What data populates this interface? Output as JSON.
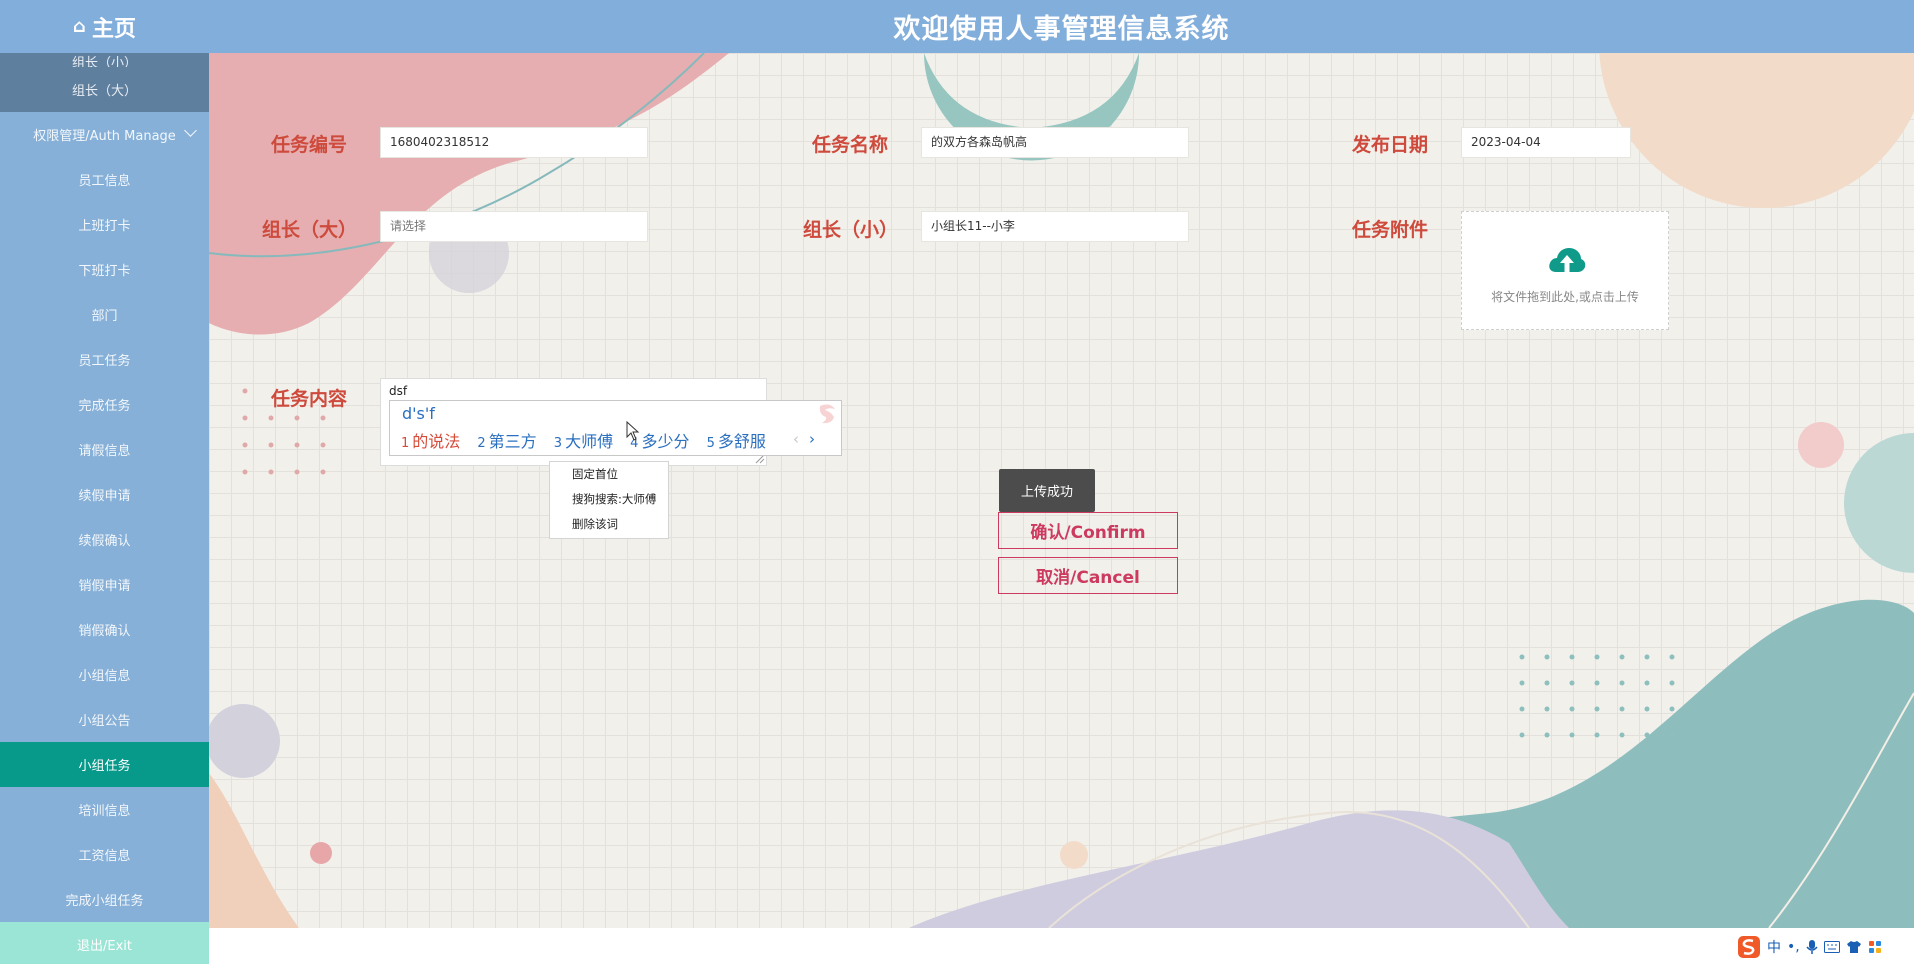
{
  "header": {
    "home_icon": "home-icon",
    "home_label": "主页",
    "title": "欢迎使用人事管理信息系统"
  },
  "sidebar": {
    "items": [
      {
        "label": "组长（小）",
        "type": "group"
      },
      {
        "label": "组长（大）",
        "type": "group"
      },
      {
        "label": "权限管理/Auth Manage",
        "type": "section",
        "icon": "chevron-down-icon"
      },
      {
        "label": "员工信息"
      },
      {
        "label": "上班打卡"
      },
      {
        "label": "下班打卡"
      },
      {
        "label": "部门"
      },
      {
        "label": "员工任务"
      },
      {
        "label": "完成任务"
      },
      {
        "label": "请假信息"
      },
      {
        "label": "续假申请"
      },
      {
        "label": "续假确认"
      },
      {
        "label": "销假申请"
      },
      {
        "label": "销假确认"
      },
      {
        "label": "小组信息"
      },
      {
        "label": "小组公告"
      },
      {
        "label": "小组任务",
        "active": true
      },
      {
        "label": "培训信息"
      },
      {
        "label": "工资信息"
      },
      {
        "label": "完成小组任务"
      },
      {
        "label": "退出/Exit",
        "type": "exit"
      }
    ]
  },
  "form": {
    "task_no": {
      "label": "任务编号",
      "value": "1680402318512"
    },
    "task_name": {
      "label": "任务名称",
      "value": "的双方各森岛帆高"
    },
    "publish_date": {
      "label": "发布日期",
      "value": "2023-04-04"
    },
    "leader_big": {
      "label": "组长（大）",
      "placeholder": "请选择"
    },
    "leader_small": {
      "label": "组长（小）",
      "value": "小组长11--小李"
    },
    "attachment": {
      "label": "任务附件",
      "icon": "cloud-upload-icon",
      "hint": "将文件拖到此处,或点击上传"
    },
    "content": {
      "label": "任务内容",
      "value": "dsf"
    }
  },
  "ime": {
    "composition": "d's'f",
    "candidates": [
      {
        "n": "1",
        "text": "的说法"
      },
      {
        "n": "2",
        "text": "第三方"
      },
      {
        "n": "3",
        "text": "大师傅"
      },
      {
        "n": "4",
        "text": "多少分"
      },
      {
        "n": "5",
        "text": "多舒服"
      }
    ],
    "prev": "‹",
    "next": "›",
    "logo_icon": "sogou-logo-icon"
  },
  "context_menu": {
    "items": [
      "固定首位",
      "搜狗搜索:大师傅",
      "删除该词"
    ]
  },
  "toast": "上传成功",
  "buttons": {
    "confirm": "确认/Confirm",
    "cancel": "取消/Cancel"
  },
  "tray": {
    "ime_mode": "中",
    "punct": "•,",
    "icons": [
      "sogou-s-icon",
      "microphone-icon",
      "keyboard-icon",
      "skin-shirt-icon",
      "toolbox-grid-icon"
    ]
  },
  "colors": {
    "header": "#82aedb",
    "sidebar": "#86b0d8",
    "sidebar_active": "#07998a",
    "label": "#cd4a3c",
    "button": "#cc3a5f",
    "toast": "#4c4c4c"
  }
}
